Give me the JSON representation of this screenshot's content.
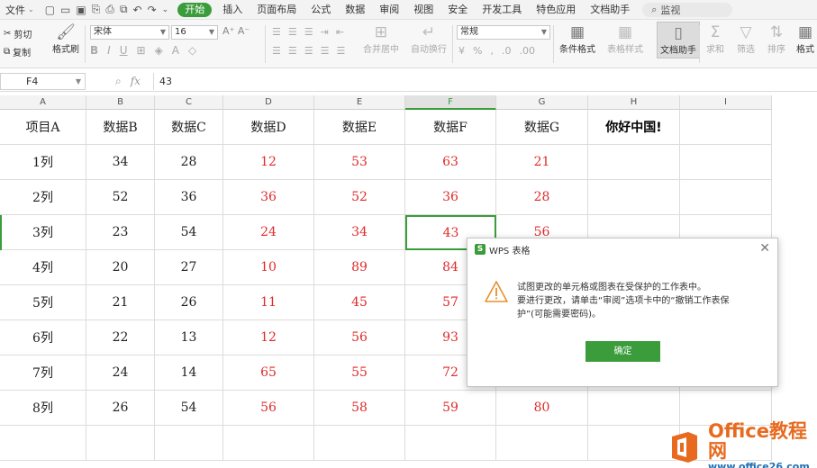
{
  "menubar": {
    "file_label": "文件",
    "tabs": [
      "开始",
      "插入",
      "页面布局",
      "公式",
      "数据",
      "审阅",
      "视图",
      "安全",
      "开发工具",
      "特色应用",
      "文档助手"
    ],
    "active_tab": "开始",
    "search_label": "监视"
  },
  "ribbon": {
    "cut": "剪切",
    "copy": "复制",
    "format_painter": "格式刷",
    "font_name": "宋体",
    "font_size": "16",
    "number_format": "常规",
    "merge_center": "合并居中",
    "wrap_text": "自动换行",
    "conditional_format": "条件格式",
    "table_style": "表格样式",
    "doc_assistant": "文档助手",
    "sum": "求和",
    "filter": "筛选",
    "sort": "排序",
    "format": "格式"
  },
  "formula_bar": {
    "cell_ref": "F4",
    "fx": "fx",
    "value": "43"
  },
  "sheet": {
    "columns": [
      "A",
      "B",
      "C",
      "D",
      "E",
      "F",
      "G",
      "H",
      "I"
    ],
    "active_column": "F",
    "header_row": [
      "项目A",
      "数据B",
      "数据C",
      "数据D",
      "数据E",
      "数据F",
      "数据G",
      "你好中国!",
      ""
    ],
    "rows": [
      [
        "1列",
        "34",
        "28",
        "12",
        "53",
        "63",
        "21",
        "",
        ""
      ],
      [
        "2列",
        "52",
        "36",
        "36",
        "52",
        "36",
        "28",
        "",
        ""
      ],
      [
        "3列",
        "23",
        "54",
        "24",
        "34",
        "43",
        "56",
        "",
        ""
      ],
      [
        "4列",
        "20",
        "27",
        "10",
        "89",
        "84",
        "",
        "",
        ""
      ],
      [
        "5列",
        "21",
        "26",
        "11",
        "45",
        "57",
        "",
        "",
        ""
      ],
      [
        "6列",
        "22",
        "13",
        "12",
        "56",
        "93",
        "",
        "",
        ""
      ],
      [
        "7列",
        "24",
        "14",
        "65",
        "55",
        "72",
        "",
        "",
        ""
      ],
      [
        "8列",
        "26",
        "54",
        "56",
        "58",
        "59",
        "80",
        "",
        ""
      ]
    ],
    "red_color": "#e02a2a",
    "selected_color": "#3a9c3a"
  },
  "dialog": {
    "title": "WPS 表格",
    "line1": "试图更改的单元格或图表在受保护的工作表中。",
    "line2": "要进行更改，请单击“审阅”选项卡中的“撤销工作表保",
    "line3": "护”(可能需要密码)。",
    "ok_label": "确定"
  },
  "watermark": {
    "brand": "Office教程网",
    "url": "www.office26.com"
  },
  "colors": {
    "accent": "#3a9c3a",
    "brand_orange": "#e86a1e",
    "brand_blue": "#1e6fb5"
  }
}
